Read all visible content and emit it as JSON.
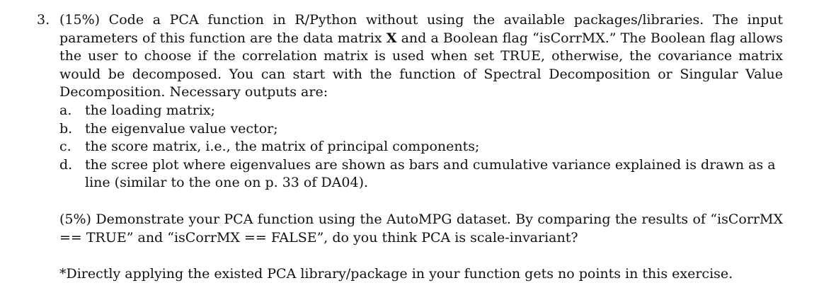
{
  "question": {
    "number": "3.",
    "intro": {
      "before_x": "(15%) Code a PCA function in R/Python without using the available packages/libraries. The input parameters of this function are the data matrix ",
      "x_symbol": "X",
      "after_x": " and a Boolean flag “isCorrMX.” The Boolean flag allows the user to choose if the correlation matrix is used when set TRUE, otherwise, the covariance matrix would be decomposed. You can start with the function of Spectral Decomposition or Singular Value Decomposition. Necessary outputs are:"
    },
    "outputs": [
      {
        "marker": "a.",
        "text": "the loading matrix;"
      },
      {
        "marker": "b.",
        "text": "the eigenvalue value vector;"
      },
      {
        "marker": "c.",
        "text": "the score matrix, i.e., the matrix of principal components;"
      },
      {
        "marker": "d.",
        "text": "the scree plot where eigenvalues are shown as bars and cumulative variance explained is drawn as a line (similar to the one on p. 33 of DA04)."
      }
    ],
    "demonstrate": "(5%) Demonstrate your PCA function using the AutoMPG dataset. By comparing the results of “isCorrMX == TRUE” and “isCorrMX == FALSE”, do you think PCA is scale-invariant?",
    "note": "*Directly applying the existed PCA library/package in your function gets no points in this exercise."
  }
}
